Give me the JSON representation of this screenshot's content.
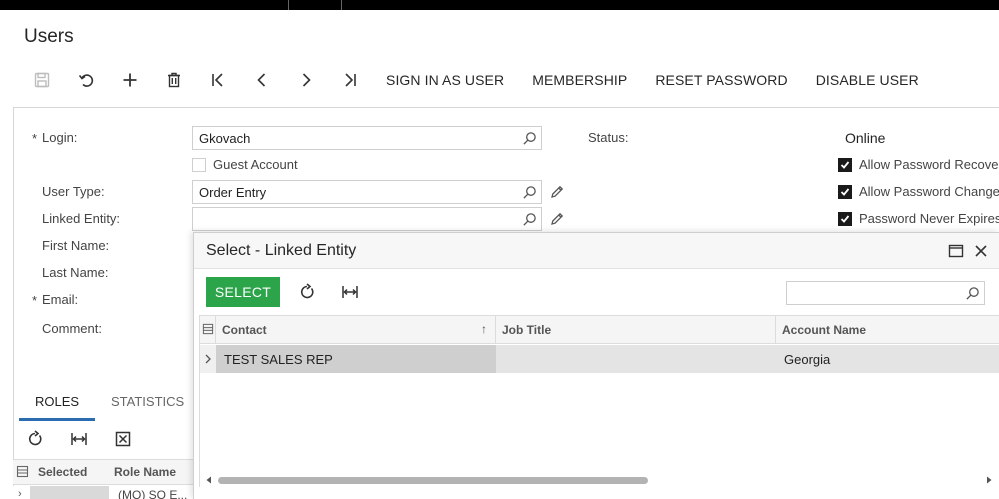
{
  "page": {
    "title": "Users"
  },
  "toolbar": {
    "icons": [
      "save-icon",
      "undo-icon",
      "add-icon",
      "delete-icon",
      "first-record-icon",
      "previous-record-icon",
      "next-record-icon",
      "last-record-icon"
    ],
    "sign_in_as_user": "SIGN IN AS USER",
    "membership": "MEMBERSHIP",
    "reset_password": "RESET PASSWORD",
    "disable_user": "DISABLE USER"
  },
  "form": {
    "required_mark": "*",
    "login_label": "Login:",
    "login_value": "Gkovach",
    "guest_account_label": "Guest Account",
    "guest_account_checked": false,
    "user_type_label": "User Type:",
    "user_type_value": "Order Entry",
    "linked_entity_label": "Linked Entity:",
    "linked_entity_value": "",
    "first_name_label": "First Name:",
    "last_name_label": "Last Name:",
    "email_label": "Email:",
    "comment_label": "Comment:",
    "status_label": "Status:",
    "status_value": "Online",
    "allow_password_recovery_label": "Allow Password Recove",
    "allow_password_recovery_checked": true,
    "allow_password_changes_label": "Allow Password Change",
    "allow_password_changes_checked": true,
    "password_never_expires_label": "Password Never Expires",
    "password_never_expires_checked": true
  },
  "tabs": [
    {
      "label": "ROLES",
      "active": true
    },
    {
      "label": "STATISTICS",
      "active": false
    }
  ],
  "roles_grid": {
    "columns": [
      "Selected",
      "Role Name"
    ],
    "partial_row_text": "(MO) SO E..."
  },
  "dialog": {
    "title": "Select - Linked Entity",
    "select_button": "SELECT",
    "search_value": "",
    "columns": [
      "Contact",
      "Job Title",
      "Account Name"
    ],
    "sort_indicator": "↑",
    "rows": [
      {
        "contact": "TEST SALES REP",
        "job_title": "",
        "account_name": "Georgia"
      }
    ]
  },
  "colors": {
    "accent_green": "#2ba44a",
    "tab_underline": "#2b6cb0",
    "top_bar": "#000000"
  }
}
